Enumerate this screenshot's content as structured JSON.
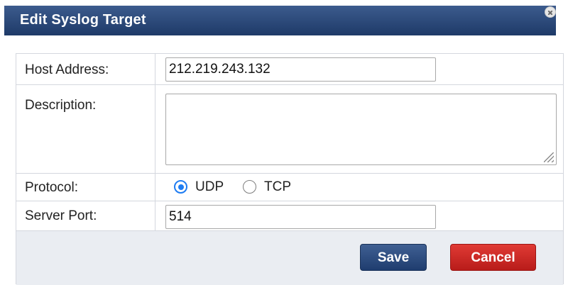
{
  "dialog": {
    "title": "Edit Syslog Target",
    "close_icon": "close-icon"
  },
  "form": {
    "host_address": {
      "label": "Host Address:",
      "value": "212.219.243.132"
    },
    "description": {
      "label": "Description:",
      "value": ""
    },
    "protocol": {
      "label": "Protocol:",
      "options": [
        {
          "label": "UDP",
          "selected": true
        },
        {
          "label": "TCP",
          "selected": false
        }
      ]
    },
    "server_port": {
      "label": "Server Port:",
      "value": "514"
    }
  },
  "buttons": {
    "save_label": "Save",
    "cancel_label": "Cancel"
  },
  "colors": {
    "titlebar": "#2b4a7a",
    "save_button": "#2a4a7e",
    "cancel_button": "#d22b27",
    "radio_accent": "#1e7cf2",
    "footer_bg": "#eaedf2"
  }
}
